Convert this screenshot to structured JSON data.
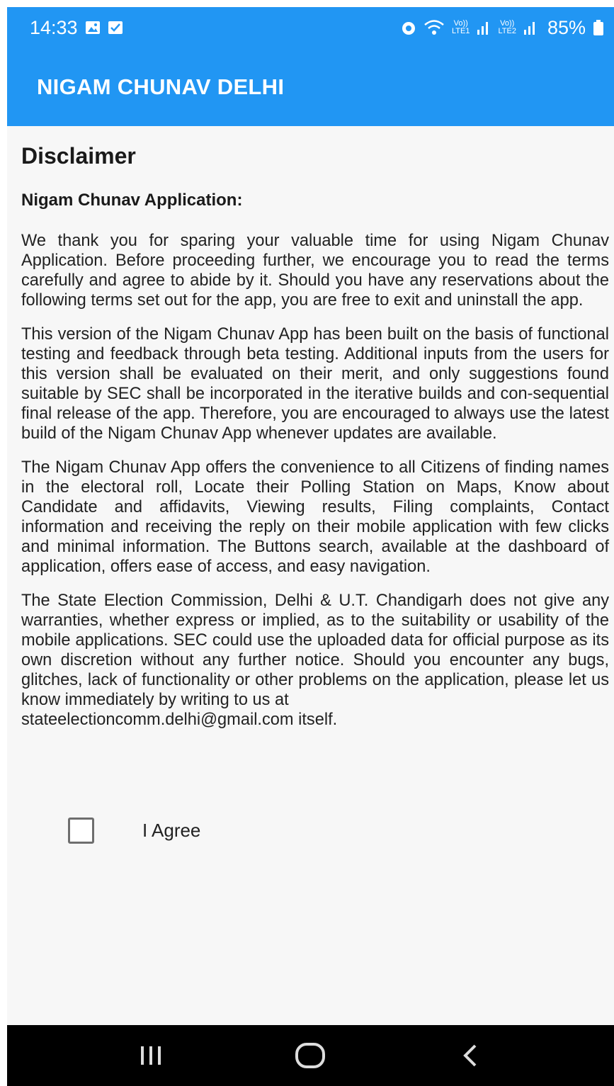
{
  "status_bar": {
    "time": "14:33",
    "sim1_label_top": "Vo))",
    "sim1_label_bottom": "LTE1",
    "sim2_label_top": "Vo))",
    "sim2_label_bottom": "LTE2",
    "battery": "85%",
    "icons": [
      "gallery-icon",
      "message-icon",
      "alarm-icon",
      "wifi-icon",
      "signal-icon",
      "battery-icon"
    ]
  },
  "app_bar": {
    "title": "NIGAM CHUNAV DELHI",
    "color": "#2196f3"
  },
  "disclaimer": {
    "title": "Disclaimer",
    "subtitle": "Nigam Chunav Application:",
    "paragraphs": [
      "We thank you for sparing your valuable time for using Nigam Chunav Application. Before proceeding further, we encourage you to read the terms carefully and agree to abide by it. Should you have any reservations about the following terms set out for the app, you are free to exit and uninstall the app.",
      "This version of the Nigam Chunav App has been built on the basis of functional testing and feedback through beta testing. Additional inputs from the users for this version shall be evaluated on their merit, and only suggestions found suitable by SEC shall be incorporated in the iterative builds and con-sequential final release of the app. Therefore, you are encouraged to always use the latest build of the Nigam Chunav App whenever updates are available.",
      "The Nigam Chunav App offers the convenience to all Citizens of finding names in the electoral roll, Locate their Polling Station on Maps, Know about Candidate and affidavits, Viewing results, Filing complaints, Contact information and receiving the reply on their mobile application with few clicks and minimal information. The Buttons search, available at the dashboard of application, offers ease of access, and easy navigation.",
      "The State Election Commission, Delhi & U.T. Chandigarh does not give any warranties, whether express or implied, as to the suitability or usability of the mobile applications. SEC could use the uploaded data for official purpose as its own discretion without any further notice. Should you encounter any bugs, glitches, lack of functionality or other problems on the application, please let us know immediately by writing to us at"
    ],
    "email_line": "stateelectioncomm.delhi@gmail.com itself."
  },
  "agree": {
    "label": "I Agree",
    "checked": false
  },
  "nav": {
    "icons": [
      "recent-apps-icon",
      "home-icon",
      "back-icon"
    ]
  }
}
